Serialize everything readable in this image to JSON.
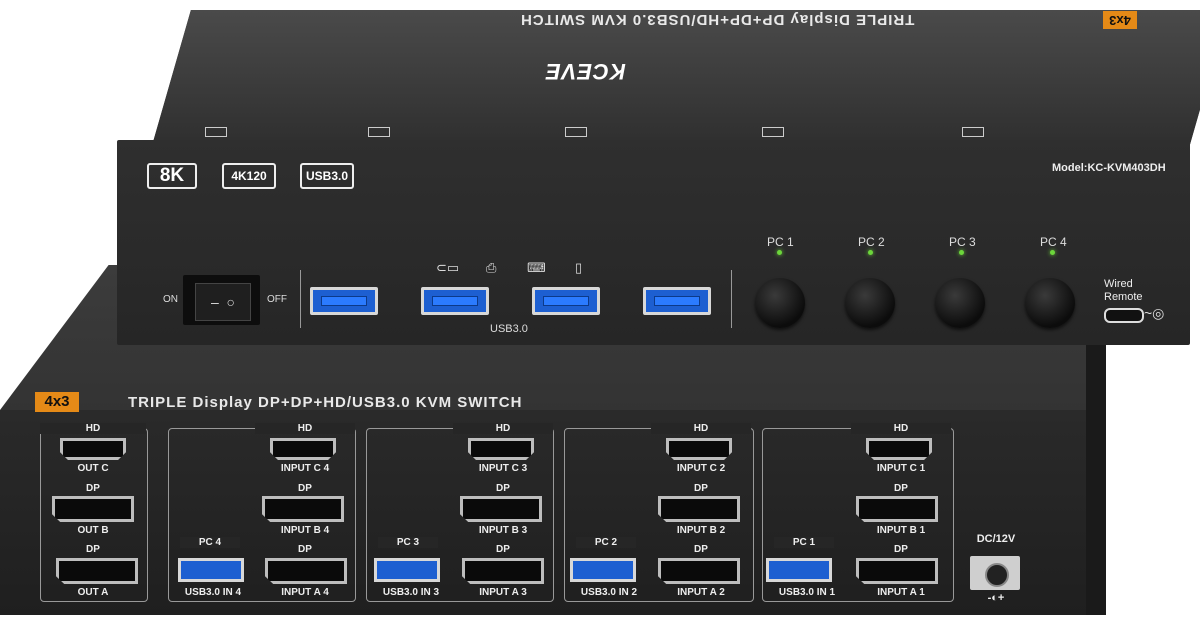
{
  "top_unit": {
    "badge": "4x3",
    "title": "TRIPLE Display DP+DP+HD/USB3.0 KVM SWITCH",
    "brand": "KCEVE",
    "model": "Model:KC-KVM403DH",
    "spec_badges": [
      "8K",
      "4K120",
      "USB3.0"
    ],
    "power": {
      "on": "ON",
      "off": "OFF"
    },
    "usb_label": "USB3.0",
    "pc_buttons": [
      "PC 1",
      "PC 2",
      "PC 3",
      "PC 4"
    ],
    "remote": {
      "line1": "Wired",
      "line2": "Remote"
    },
    "led_color": "#6cd63b"
  },
  "bottom_unit": {
    "badge": "4x3",
    "title": "TRIPLE Display DP+DP+HD/USB3.0 KVM SWITCH",
    "outputs": {
      "hd": "HD",
      "dp1": "DP",
      "dp2": "DP",
      "out_c": "OUT C",
      "out_b": "OUT B",
      "out_a": "OUT A"
    },
    "pc_groups": [
      {
        "pc": "PC 4",
        "hd": "HD",
        "dp1": "DP",
        "dp2": "DP",
        "in_c": "INPUT C 4",
        "in_b": "INPUT B 4",
        "in_a": "INPUT A 4",
        "usb": "USB3.0 IN 4"
      },
      {
        "pc": "PC 3",
        "hd": "HD",
        "dp1": "DP",
        "dp2": "DP",
        "in_c": "INPUT C 3",
        "in_b": "INPUT B 3",
        "in_a": "INPUT A 3",
        "usb": "USB3.0 IN 3"
      },
      {
        "pc": "PC 2",
        "hd": "HD",
        "dp1": "DP",
        "dp2": "DP",
        "in_c": "INPUT C 2",
        "in_b": "INPUT B 2",
        "in_a": "INPUT A 2",
        "usb": "USB3.0 IN 2"
      },
      {
        "pc": "PC 1",
        "hd": "HD",
        "dp1": "DP",
        "dp2": "DP",
        "in_c": "INPUT C 1",
        "in_b": "INPUT B 1",
        "in_a": "INPUT A 1",
        "usb": "USB3.0 IN 1"
      }
    ],
    "dc": "DC/12V",
    "dc_polarity": "-◐+"
  },
  "colors": {
    "accent": "#e58a17",
    "usb_blue": "#1d5fd1",
    "body": "#2a2a2a"
  }
}
